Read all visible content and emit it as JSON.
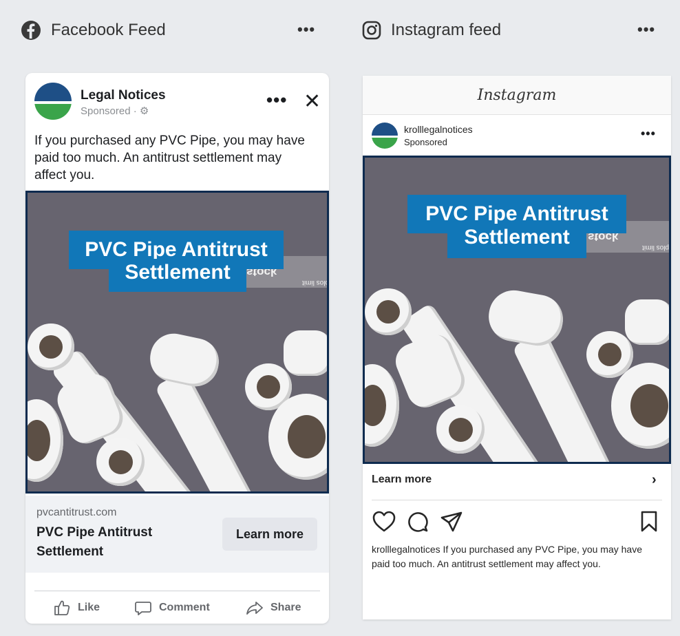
{
  "facebook_panel": {
    "header_title": "Facebook Feed",
    "menu_label": "•••",
    "post": {
      "page_name": "Legal Notices",
      "sponsored_label": "Sponsored · ⚙",
      "more_label": "•••",
      "close_label": "✕",
      "body_text": "If you purchased any PVC Pipe, you may have paid too much. An antitrust settlement may affect you.",
      "image_headline_line1": "PVC Pipe Antitrust",
      "image_headline_line2": "Settlement",
      "stock_text": "stock",
      "stock_small": "plos limit",
      "link_domain": "pvcantitrust.com",
      "link_title": "PVC Pipe Antitrust Settlement",
      "cta_label": "Learn more",
      "actions": {
        "like": "Like",
        "comment": "Comment",
        "share": "Share"
      }
    }
  },
  "instagram_panel": {
    "header_title": "Instagram feed",
    "menu_label": "•••",
    "post": {
      "app_logo_text": "Instagram",
      "username": "krolllegalnotices",
      "sponsored_label": "Sponsored",
      "more_label": "•••",
      "image_headline_line1": "PVC Pipe Antitrust",
      "image_headline_line2": "Settlement",
      "stock_text": "stock",
      "stock_small": "plos limit",
      "cta_label": "Learn more",
      "cta_chevron": "›",
      "caption_user": "krolllegalnotices",
      "caption_text": " If you purchased any PVC Pipe, you may have paid too much. An antitrust settlement may affect you."
    }
  },
  "colors": {
    "page_bg": "#e9ebee",
    "headline_blue": "#1177b8",
    "image_border": "#0e2b4f",
    "avatar_blue": "#1e4f86",
    "avatar_green": "#3aa44a"
  },
  "icons": {
    "facebook_logo": "facebook-logo-icon",
    "instagram_logo": "instagram-logo-icon",
    "like": "thumbs-up-icon",
    "comment": "comment-bubble-icon",
    "share": "share-arrow-icon",
    "heart": "heart-icon",
    "ig_comment": "ig-comment-icon",
    "send": "send-icon",
    "bookmark": "bookmark-icon"
  }
}
